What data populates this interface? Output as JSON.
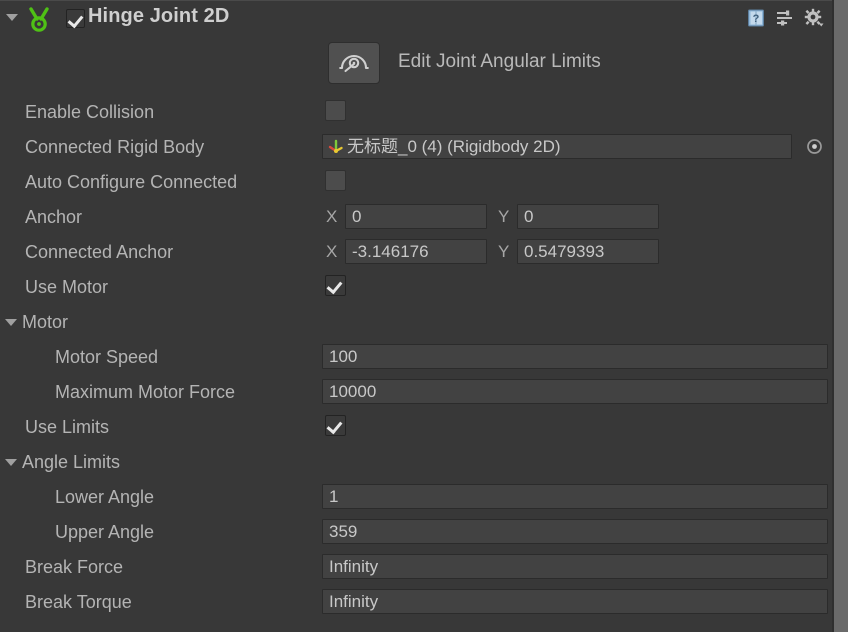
{
  "component": {
    "title": "Hinge Joint 2D",
    "enabled": true,
    "icon": "hinge-joint-2d-icon",
    "header_icons": [
      "help-book-icon",
      "preset-sliders-icon",
      "gear-settings-icon"
    ]
  },
  "edit_tool": {
    "icon": "edit-joint-angular-limits-icon",
    "label": "Edit Joint Angular Limits"
  },
  "rows": [
    {
      "name": "enable-collision",
      "label": "Enable Collision",
      "type": "checkbox",
      "value": false,
      "indent": 0
    },
    {
      "name": "connected-rigid-body",
      "label": "Connected Rigid Body",
      "type": "object",
      "value": "无标题_0 (4) (Rigidbody 2D)",
      "indent": 0
    },
    {
      "name": "auto-configure-connected",
      "label": "Auto Configure Connected",
      "type": "checkbox",
      "value": false,
      "indent": 0
    },
    {
      "name": "anchor",
      "label": "Anchor",
      "type": "vector2",
      "x": "0",
      "y": "0",
      "indent": 0
    },
    {
      "name": "connected-anchor",
      "label": "Connected Anchor",
      "type": "vector2",
      "x": "-3.146176",
      "y": "0.5479393",
      "indent": 0
    },
    {
      "name": "use-motor",
      "label": "Use Motor",
      "type": "checkbox",
      "value": true,
      "indent": 0
    },
    {
      "name": "motor",
      "label": "Motor",
      "type": "foldout",
      "expanded": true,
      "indent": 0
    },
    {
      "name": "motor-speed",
      "label": "Motor Speed",
      "type": "text",
      "value": "100",
      "indent": 1
    },
    {
      "name": "maximum-motor-force",
      "label": "Maximum Motor Force",
      "type": "text",
      "value": "10000",
      "indent": 1
    },
    {
      "name": "use-limits",
      "label": "Use Limits",
      "type": "checkbox",
      "value": true,
      "indent": 0
    },
    {
      "name": "angle-limits",
      "label": "Angle Limits",
      "type": "foldout",
      "expanded": true,
      "indent": 0
    },
    {
      "name": "lower-angle",
      "label": "Lower Angle",
      "type": "text",
      "value": "1",
      "indent": 1
    },
    {
      "name": "upper-angle",
      "label": "Upper Angle",
      "type": "text",
      "value": "359",
      "indent": 1
    },
    {
      "name": "break-force",
      "label": "Break Force",
      "type": "text",
      "value": "Infinity",
      "indent": 0
    },
    {
      "name": "break-torque",
      "label": "Break Torque",
      "type": "text",
      "value": "Infinity",
      "indent": 0
    }
  ],
  "axis_labels": {
    "x": "X",
    "y": "Y"
  },
  "colors": {
    "background": "#383838",
    "field": "#424242",
    "text": "#b4b4b4",
    "icon_green": "#56c81e",
    "scrollbar": "#6a6a6a"
  }
}
